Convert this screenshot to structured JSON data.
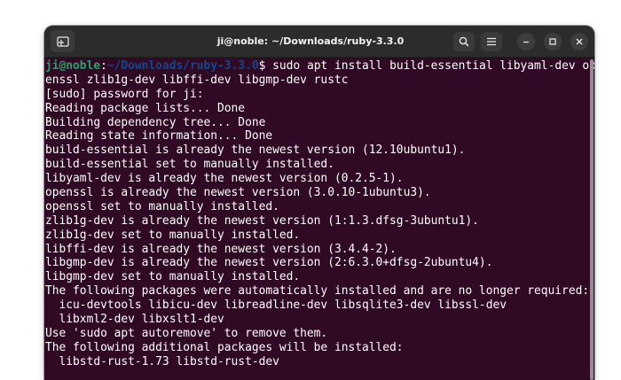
{
  "window": {
    "title": "ji@noble: ~/Downloads/ruby-3.3.0",
    "background": "#300a24",
    "titlebar_color": "#2c2c2c"
  },
  "titlebar": {
    "new_tab_icon": "new-tab-icon",
    "search_icon": "search-icon",
    "menu_icon": "hamburger-menu-icon",
    "minimize_icon": "minimize-icon",
    "maximize_icon": "maximize-icon",
    "close_icon": "close-icon"
  },
  "prompt": {
    "user_host": "ji@noble",
    "colon": ":",
    "path": "~/Downloads/ruby-3.3.0",
    "dollar": "$",
    "command": " sudo apt install build-essential libyaml-dev op",
    "user_color": "#26a269",
    "path_color": "#12488b"
  },
  "output_lines": [
    "enssl zlib1g-dev libffi-dev libgmp-dev rustc",
    "[sudo] password for ji:",
    "Reading package lists... Done",
    "Building dependency tree... Done",
    "Reading state information... Done",
    "build-essential is already the newest version (12.10ubuntu1).",
    "build-essential set to manually installed.",
    "libyaml-dev is already the newest version (0.2.5-1).",
    "openssl is already the newest version (3.0.10-1ubuntu3).",
    "openssl set to manually installed.",
    "zlib1g-dev is already the newest version (1:1.3.dfsg-3ubuntu1).",
    "zlib1g-dev set to manually installed.",
    "libffi-dev is already the newest version (3.4.4-2).",
    "libgmp-dev is already the newest version (2:6.3.0+dfsg-2ubuntu4).",
    "libgmp-dev set to manually installed.",
    "The following packages were automatically installed and are no longer required:",
    "  icu-devtools libicu-dev libreadline-dev libsqlite3-dev libssl-dev",
    "  libxml2-dev libxslt1-dev",
    "Use 'sudo apt autoremove' to remove them.",
    "The following additional packages will be installed:",
    "  libstd-rust-1.73 libstd-rust-dev"
  ]
}
